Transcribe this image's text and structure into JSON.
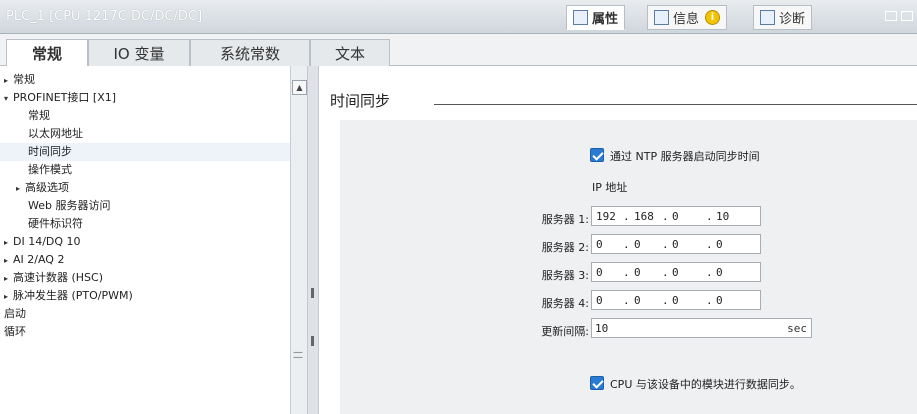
{
  "titlebar": {
    "title": "PLC_1 [CPU 1217C DC/DC/DC]",
    "tabs": [
      {
        "label": "属性",
        "icon": "properties-icon"
      },
      {
        "label": "信息",
        "icon": "info-icon",
        "badge": "i"
      },
      {
        "label": "诊断",
        "icon": "diagnostics-icon"
      }
    ]
  },
  "section_tabs": [
    "常规",
    "IO 变量",
    "系统常数",
    "文本"
  ],
  "tree": [
    {
      "label": "常规",
      "level": 0,
      "arrow": "▸"
    },
    {
      "label": "PROFINET接口 [X1]",
      "level": 0,
      "arrow": "▾"
    },
    {
      "label": "常规",
      "level": 2,
      "arrow": ""
    },
    {
      "label": "以太网地址",
      "level": 2,
      "arrow": ""
    },
    {
      "label": "时间同步",
      "level": 2,
      "arrow": ""
    },
    {
      "label": "操作模式",
      "level": 2,
      "arrow": ""
    },
    {
      "label": "高级选项",
      "level": 1,
      "arrow": "▸"
    },
    {
      "label": "Web 服务器访问",
      "level": 2,
      "arrow": ""
    },
    {
      "label": "硬件标识符",
      "level": 2,
      "arrow": ""
    },
    {
      "label": "DI 14/DQ 10",
      "level": 0,
      "arrow": "▸"
    },
    {
      "label": "AI 2/AQ 2",
      "level": 0,
      "arrow": "▸"
    },
    {
      "label": "高速计数器 (HSC)",
      "level": 0,
      "arrow": "▸"
    },
    {
      "label": "脉冲发生器 (PTO/PWM)",
      "level": 0,
      "arrow": "▸"
    },
    {
      "label": "启动",
      "level": 0,
      "arrow": ""
    },
    {
      "label": "循环",
      "level": 0,
      "arrow": ""
    }
  ],
  "content": {
    "title": "时间同步",
    "ntp_checkbox_label": "通过 NTP 服务器启动同步时间",
    "ip_header": "IP 地址",
    "servers": [
      {
        "label": "服务器 1:",
        "octets": [
          "192",
          "168",
          "0",
          "10"
        ]
      },
      {
        "label": "服务器 2:",
        "octets": [
          "0",
          "0",
          "0",
          "0"
        ]
      },
      {
        "label": "服务器 3:",
        "octets": [
          "0",
          "0",
          "0",
          "0"
        ]
      },
      {
        "label": "服务器 4:",
        "octets": [
          "0",
          "0",
          "0",
          "0"
        ]
      }
    ],
    "interval_label": "更新间隔:",
    "interval_value": "10",
    "interval_unit": "sec",
    "cpu_sync_label": "CPU 与该设备中的模块进行数据同步。"
  }
}
